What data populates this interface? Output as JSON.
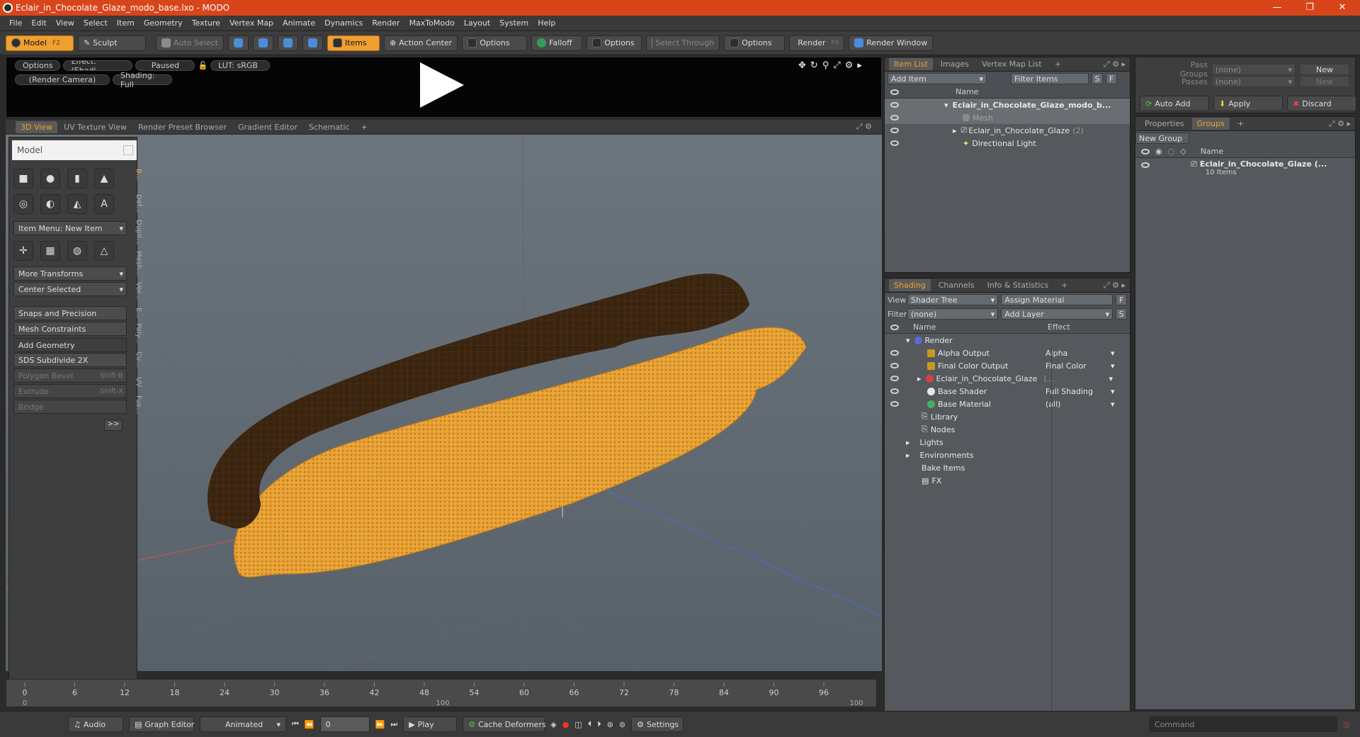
{
  "window": {
    "title": "Eclair_in_Chocolate_Glaze_modo_base.lxo - MODO",
    "minimize": "—",
    "restore": "❐",
    "close": "✕"
  },
  "menu": [
    "File",
    "Edit",
    "View",
    "Select",
    "Item",
    "Geometry",
    "Texture",
    "Vertex Map",
    "Animate",
    "Dynamics",
    "Render",
    "MaxToModo",
    "Layout",
    "System",
    "Help"
  ],
  "toolbar": {
    "model": "Model",
    "model_key": "F2",
    "sculpt": "Sculpt",
    "auto_select": "Auto Select",
    "items": "Items",
    "action_center": "Action Center",
    "options1": "Options",
    "falloff": "Falloff",
    "options2": "Options",
    "select_through": "Select Through",
    "options3": "Options",
    "render": "Render",
    "render_key": "F9",
    "render_window": "Render Window"
  },
  "preview": {
    "options": "Options",
    "effect": "Effect: (Shadi...",
    "paused": "Paused",
    "lut": "LUT: sRGB",
    "camera": "(Render Camera)",
    "shading": "Shading: Full"
  },
  "viewport_tabs": [
    "3D View",
    "UV Texture View",
    "Render Preset Browser",
    "Gradient Editor",
    "Schematic"
  ],
  "toolpanel": {
    "title": "Model",
    "item_menu": "Item Menu: New Item",
    "more_transforms": "More Transforms",
    "center_selected": "Center Selected",
    "snaps": "Snaps and Precision",
    "mesh_constraints": "Mesh Constraints",
    "add_geometry": "Add Geometry",
    "sds": "SDS Subdivide 2X",
    "polygon_bevel": "Polygon Bevel",
    "polygon_bevel_key": "Shift-B",
    "extrude": "Extrude",
    "extrude_key": "Shift-X",
    "bridge": "Bridge",
    "expand": ">>",
    "vtabs": [
      "B...",
      "Def...",
      "Dupli...",
      "Mesh...",
      "Ver...",
      "E...",
      "Poly...",
      "Cu...",
      "UV",
      "Fus..."
    ]
  },
  "itemlist": {
    "tabs": [
      "Item List",
      "Images",
      "Vertex Map List"
    ],
    "add_item": "Add Item",
    "filter_items": "Filter Items",
    "s": "S",
    "f": "F",
    "col_name": "Name",
    "rows": [
      {
        "name": "Eclair_in_Chocolate_Glaze_modo_b...",
        "count": ""
      },
      {
        "name": "Mesh",
        "count": ""
      },
      {
        "name": "Eclair_in_Chocolate_Glaze",
        "count": "(2)"
      },
      {
        "name": "Directional Light",
        "count": ""
      }
    ]
  },
  "shading": {
    "tabs": [
      "Shading",
      "Channels",
      "Info & Statistics"
    ],
    "view_label": "View",
    "view_value": "Shader Tree",
    "assign_material": "Assign Material",
    "f": "F",
    "filter_label": "Filter",
    "filter_value": "(none)",
    "add_layer": "Add Layer",
    "s": "S",
    "col_name": "Name",
    "col_effect": "Effect",
    "rows": [
      {
        "name": "Render",
        "effect": ""
      },
      {
        "name": "Alpha Output",
        "effect": "Alpha"
      },
      {
        "name": "Final Color Output",
        "effect": "Final Color"
      },
      {
        "name": "Eclair_in_Chocolate_Glaze",
        "effect": "(..."
      },
      {
        "name": "Base Shader",
        "effect": "Full Shading"
      },
      {
        "name": "Base Material",
        "effect": "(all)"
      },
      {
        "name": "Library",
        "effect": ""
      },
      {
        "name": "Nodes",
        "effect": ""
      },
      {
        "name": "Lights",
        "effect": ""
      },
      {
        "name": "Environments",
        "effect": ""
      },
      {
        "name": "Bake Items",
        "effect": ""
      },
      {
        "name": "FX",
        "effect": ""
      }
    ]
  },
  "passes": {
    "pass_groups": "Pass Groups",
    "passes": "Passes",
    "none": "(none)",
    "new": "New",
    "auto_add": "Auto Add",
    "apply": "Apply",
    "discard": "Discard"
  },
  "groups": {
    "tabs": [
      "Properties",
      "Groups"
    ],
    "new_group": "New Group",
    "col_name": "Name",
    "group_name": "Eclair_in_Chocolate_Glaze (...",
    "group_items": "10 Items"
  },
  "timeline": {
    "ticks": [
      "0",
      "6",
      "12",
      "18",
      "24",
      "30",
      "36",
      "42",
      "48",
      "54",
      "60",
      "66",
      "72",
      "78",
      "84",
      "90",
      "96"
    ],
    "ticks_low": [
      "0",
      "100",
      "100"
    ]
  },
  "bottom": {
    "audio": "Audio",
    "graph_editor": "Graph Editor",
    "animated": "Animated",
    "frame": "0",
    "play": "Play",
    "cache": "Cache Deformers",
    "settings": "Settings",
    "command": "Command"
  },
  "colors": {
    "accent": "#f0a030",
    "title_bar": "#d9451b",
    "chocolate": "#3a2410",
    "pastry": "#e8a030"
  }
}
